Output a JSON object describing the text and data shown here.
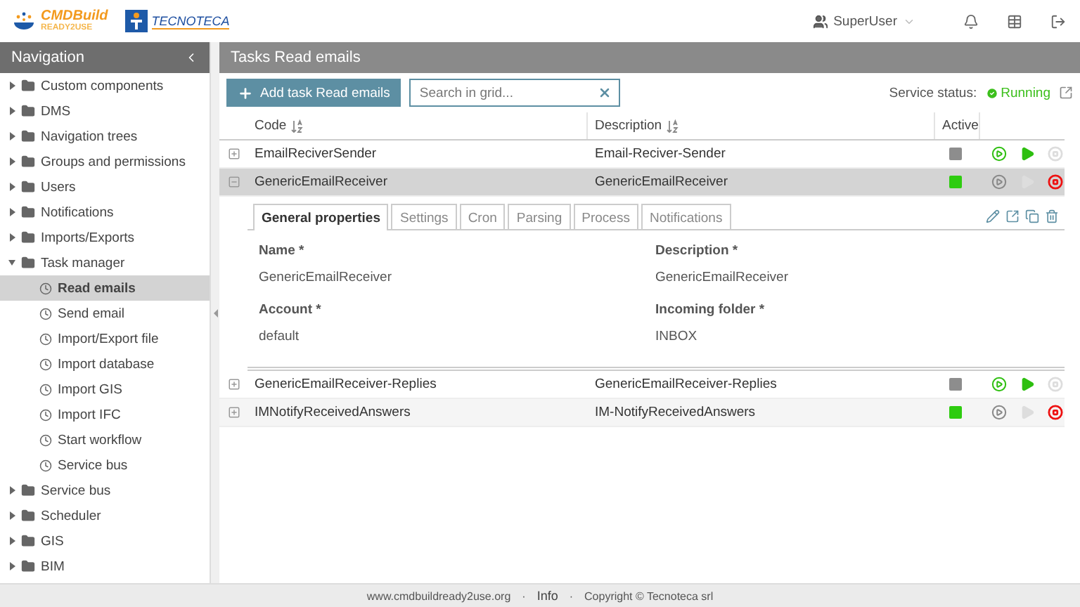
{
  "logo": {
    "brand": "CMDBuild",
    "tagline": "READY2USE",
    "partner": "TECNOTECA"
  },
  "user": {
    "name": "SuperUser"
  },
  "sidebar": {
    "title": "Navigation",
    "items": [
      {
        "kind": "folder",
        "label": "Custom components",
        "expanded": false,
        "selected": false
      },
      {
        "kind": "folder",
        "label": "DMS",
        "expanded": false,
        "selected": false
      },
      {
        "kind": "folder",
        "label": "Navigation trees",
        "expanded": false,
        "selected": false
      },
      {
        "kind": "folder",
        "label": "Groups and permissions",
        "expanded": false,
        "selected": false
      },
      {
        "kind": "folder",
        "label": "Users",
        "expanded": false,
        "selected": false
      },
      {
        "kind": "folder",
        "label": "Notifications",
        "expanded": false,
        "selected": false
      },
      {
        "kind": "folder",
        "label": "Imports/Exports",
        "expanded": false,
        "selected": false
      },
      {
        "kind": "folder",
        "label": "Task manager",
        "expanded": true,
        "selected": false,
        "children": [
          {
            "kind": "task",
            "label": "Read emails",
            "selected": true
          },
          {
            "kind": "task",
            "label": "Send email",
            "selected": false
          },
          {
            "kind": "task",
            "label": "Import/Export file",
            "selected": false
          },
          {
            "kind": "task",
            "label": "Import database",
            "selected": false
          },
          {
            "kind": "task",
            "label": "Import GIS",
            "selected": false
          },
          {
            "kind": "task",
            "label": "Import IFC",
            "selected": false
          },
          {
            "kind": "task",
            "label": "Start workflow",
            "selected": false
          },
          {
            "kind": "task",
            "label": "Service bus",
            "selected": false
          }
        ]
      },
      {
        "kind": "folder",
        "label": "Service bus",
        "expanded": false,
        "selected": false
      },
      {
        "kind": "folder",
        "label": "Scheduler",
        "expanded": false,
        "selected": false
      },
      {
        "kind": "folder",
        "label": "GIS",
        "expanded": false,
        "selected": false
      },
      {
        "kind": "folder",
        "label": "BIM",
        "expanded": false,
        "selected": false
      }
    ]
  },
  "page": {
    "title": "Tasks Read emails"
  },
  "toolbar": {
    "add_button": "Add task Read emails",
    "search": {
      "placeholder": "Search in grid..."
    },
    "status_label": "Service status:",
    "status_value": "Running",
    "running": true
  },
  "table": {
    "columns": [
      "Code",
      "Description",
      "Active"
    ],
    "rows": [
      {
        "code": "EmailReciverSender",
        "description": "Email-Reciver-Sender",
        "active": false,
        "expanded": false,
        "selected": false
      },
      {
        "code": "GenericEmailReceiver",
        "description": "GenericEmailReceiver",
        "active": true,
        "expanded": true,
        "selected": true
      },
      {
        "code": "GenericEmailReceiver-Replies",
        "description": "GenericEmailReceiver-Replies",
        "active": false,
        "expanded": false,
        "selected": false
      },
      {
        "code": "IMNotifyReceivedAnswers",
        "description": "IM-NotifyReceivedAnswers",
        "active": true,
        "expanded": false,
        "selected": false
      }
    ]
  },
  "detail": {
    "tabs": [
      {
        "label": "General properties",
        "selected": true
      },
      {
        "label": "Settings",
        "selected": false
      },
      {
        "label": "Cron",
        "selected": false
      },
      {
        "label": "Parsing",
        "selected": false
      },
      {
        "label": "Process",
        "selected": false
      },
      {
        "label": "Notifications",
        "selected": false
      }
    ],
    "fields": [
      {
        "label": "Name *",
        "value": "GenericEmailReceiver"
      },
      {
        "label": "Description *",
        "value": "GenericEmailReceiver"
      },
      {
        "label": "Account *",
        "value": "default"
      },
      {
        "label": "Incoming folder *",
        "value": "INBOX"
      }
    ]
  },
  "footer": [
    {
      "kind": "text",
      "label": "www.cmdbuildready2use.org"
    },
    {
      "kind": "sep",
      "label": "·"
    },
    {
      "kind": "link",
      "label": "Info"
    },
    {
      "kind": "sep",
      "label": "·"
    },
    {
      "kind": "text",
      "label": "Copyright © Tecnoteca srl"
    }
  ]
}
